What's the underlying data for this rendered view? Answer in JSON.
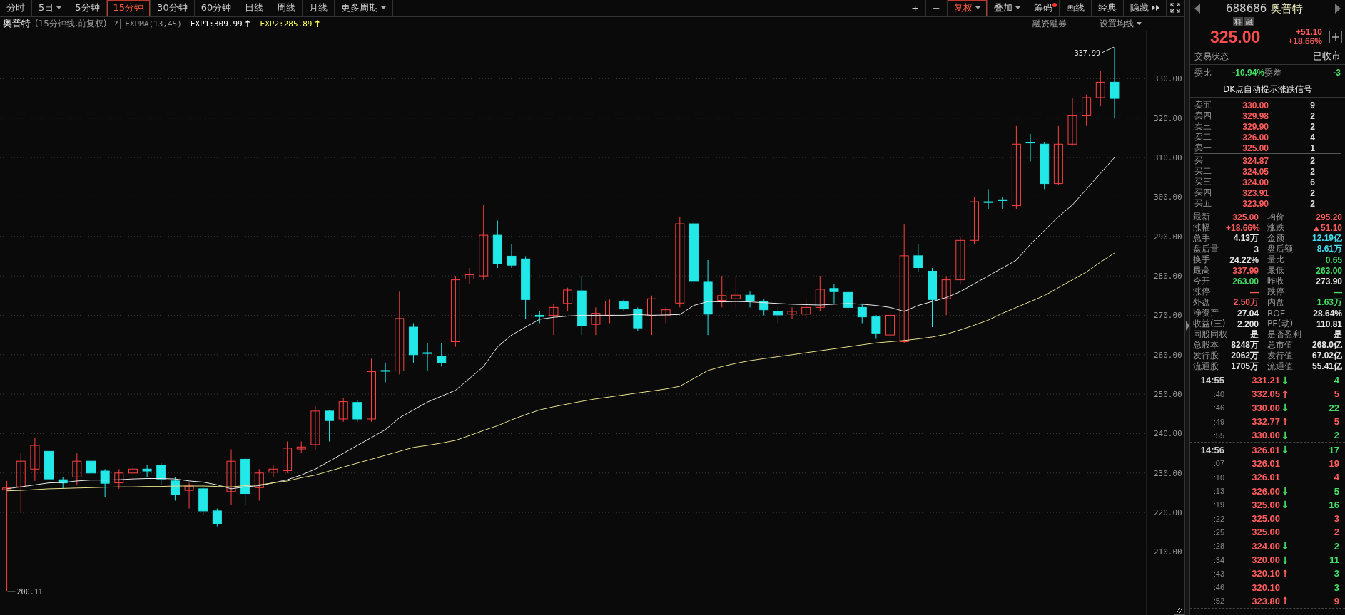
{
  "periods": [
    {
      "label": "分时",
      "selected": false,
      "dropdown": false
    },
    {
      "label": "5日",
      "selected": false,
      "dropdown": true
    },
    {
      "label": "5分钟",
      "selected": false,
      "dropdown": false
    },
    {
      "label": "15分钟",
      "selected": true,
      "dropdown": false
    },
    {
      "label": "30分钟",
      "selected": false,
      "dropdown": false
    },
    {
      "label": "60分钟",
      "selected": false,
      "dropdown": false
    },
    {
      "label": "日线",
      "selected": false,
      "dropdown": false
    },
    {
      "label": "周线",
      "selected": false,
      "dropdown": false
    },
    {
      "label": "月线",
      "selected": false,
      "dropdown": false
    },
    {
      "label": "更多周期",
      "selected": false,
      "dropdown": true
    }
  ],
  "tools": [
    {
      "kind": "text",
      "label": "+",
      "selected": false,
      "dropdown": false,
      "dot": false
    },
    {
      "kind": "text",
      "label": "−",
      "selected": false,
      "dropdown": false,
      "dot": false
    },
    {
      "kind": "text",
      "label": "复权",
      "selected": true,
      "dropdown": true,
      "dot": false
    },
    {
      "kind": "text",
      "label": "叠加",
      "selected": false,
      "dropdown": true,
      "dot": false
    },
    {
      "kind": "text",
      "label": "筹码",
      "selected": false,
      "dropdown": false,
      "dot": true
    },
    {
      "kind": "text",
      "label": "画线",
      "selected": false,
      "dropdown": false,
      "dot": false
    },
    {
      "kind": "text",
      "label": "经典",
      "selected": false,
      "dropdown": false,
      "dot": false
    },
    {
      "kind": "hide",
      "label": "隐藏",
      "selected": false
    },
    {
      "kind": "fullscreen",
      "selected": false
    }
  ],
  "info": {
    "name": "奥普特",
    "description": "(15分钟线,前复权)",
    "help": "?",
    "indicator": "EXPMA(13,45)",
    "values": [
      {
        "text": "EXP1:309.99",
        "color": "#ffffff",
        "arrow": "↑"
      },
      {
        "text": "EXP2:285.89",
        "color": "#ffff55",
        "arrow": "↑"
      }
    ],
    "links": [
      {
        "label": "融资融券",
        "dropdown": false
      },
      {
        "label": "设置均线",
        "dropdown": true
      }
    ]
  },
  "chart": {
    "chart_data": {
      "type": "candlestick",
      "ylim": [
        194,
        342
      ],
      "grid": true,
      "yticks": [
        {
          "value": 210,
          "label": "210.00"
        },
        {
          "value": 220,
          "label": "220.00"
        },
        {
          "value": 230,
          "label": "230.00"
        },
        {
          "value": 240,
          "label": "240.00"
        },
        {
          "value": 250,
          "label": "250.00"
        },
        {
          "value": 260,
          "label": "260.00"
        },
        {
          "value": 270,
          "label": "270.00"
        },
        {
          "value": 280,
          "label": "280.00"
        },
        {
          "value": 290,
          "label": "290.00"
        },
        {
          "value": 300,
          "label": "300.00"
        },
        {
          "value": 310,
          "label": "310.00"
        },
        {
          "value": 320,
          "label": "320.00"
        },
        {
          "value": 330,
          "label": "330.00"
        }
      ],
      "ohlc": [
        [
          225.8,
          228,
          200,
          226.2
        ],
        [
          226.5,
          235,
          220,
          233
        ],
        [
          231,
          239,
          228,
          237
        ],
        [
          235.5,
          236,
          227,
          228.5
        ],
        [
          228.3,
          229,
          226,
          227.5
        ],
        [
          229,
          235,
          227,
          233
        ],
        [
          233,
          234,
          229,
          230
        ],
        [
          230.5,
          231,
          224,
          227.4
        ],
        [
          227.5,
          231,
          226,
          230
        ],
        [
          230,
          232,
          228,
          231
        ],
        [
          231,
          232,
          229,
          230.5
        ],
        [
          232,
          232.5,
          227,
          228.5
        ],
        [
          228,
          229,
          223,
          224.5
        ],
        [
          225.6,
          227.5,
          221,
          226.7
        ],
        [
          226,
          226.5,
          219.5,
          220.4
        ],
        [
          220.4,
          221,
          216.5,
          217.1
        ],
        [
          225.3,
          236,
          222,
          233
        ],
        [
          233.5,
          234,
          222,
          224.8
        ],
        [
          226.3,
          231,
          223,
          230
        ],
        [
          230.2,
          232,
          229,
          231
        ],
        [
          230.6,
          238,
          230,
          236.3
        ],
        [
          236.1,
          238,
          235,
          236.6
        ],
        [
          237.2,
          247,
          236,
          245.7
        ],
        [
          245.7,
          246,
          238,
          243.3
        ],
        [
          243.7,
          249,
          243,
          248.1
        ],
        [
          247.9,
          248.5,
          243,
          243.7
        ],
        [
          243.7,
          259,
          243,
          255.7
        ],
        [
          256,
          258,
          253,
          255.8
        ],
        [
          255.9,
          276,
          255,
          269.2
        ],
        [
          267,
          268,
          258,
          260
        ],
        [
          260.5,
          263,
          256,
          260.3
        ],
        [
          259.6,
          263,
          257,
          258
        ],
        [
          263.3,
          280,
          262,
          279
        ],
        [
          279.2,
          282,
          278,
          280.3
        ],
        [
          280,
          298,
          279,
          290.3
        ],
        [
          290.3,
          294,
          282,
          283
        ],
        [
          285,
          288,
          282,
          282.7
        ],
        [
          284.3,
          285,
          269,
          274
        ],
        [
          270,
          271,
          268,
          269.7
        ],
        [
          270,
          273,
          265,
          272
        ],
        [
          273,
          277,
          271,
          276.4
        ],
        [
          276.2,
          280,
          265,
          267.3
        ],
        [
          267.7,
          272,
          265,
          270.5
        ],
        [
          270,
          274,
          268,
          273.6
        ],
        [
          273.4,
          274,
          271,
          271.6
        ],
        [
          271.6,
          272,
          266,
          266.8
        ],
        [
          270,
          275,
          265,
          274.2
        ],
        [
          269.9,
          272,
          268,
          271.4
        ],
        [
          273.1,
          295,
          272,
          293.2
        ],
        [
          293.2,
          294,
          278,
          278.6
        ],
        [
          278.4,
          284,
          265,
          270.3
        ],
        [
          273.8,
          280,
          272,
          275
        ],
        [
          274.2,
          280,
          272,
          275.1
        ],
        [
          275.1,
          276,
          272,
          273.6
        ],
        [
          273.6,
          274,
          270,
          271.4
        ],
        [
          271,
          272,
          268,
          270.1
        ],
        [
          270.3,
          272,
          269,
          271
        ],
        [
          270.3,
          274,
          269,
          272
        ],
        [
          272,
          280,
          271,
          276.6
        ],
        [
          276.8,
          278,
          273,
          276
        ],
        [
          275.8,
          276,
          271,
          272
        ],
        [
          272,
          273,
          268,
          269.6
        ],
        [
          269.6,
          270,
          264,
          265.5
        ],
        [
          265,
          272,
          263,
          270
        ],
        [
          263.3,
          293,
          263,
          285.1
        ],
        [
          285.1,
          288,
          281,
          282.1
        ],
        [
          281.2,
          282,
          267,
          274
        ],
        [
          274.2,
          280,
          270,
          279
        ],
        [
          279,
          290,
          278,
          289
        ],
        [
          289,
          300,
          288,
          298.8
        ],
        [
          298.8,
          302,
          297,
          298.6
        ],
        [
          299.3,
          300,
          297,
          299.1
        ],
        [
          297.8,
          318,
          297,
          313.4
        ],
        [
          313.9,
          316,
          309,
          313.7
        ],
        [
          313.4,
          314,
          302,
          303.4
        ],
        [
          303.4,
          318,
          303,
          313.4
        ],
        [
          313.4,
          325,
          313,
          320.6
        ],
        [
          320.6,
          326,
          318,
          325.2
        ],
        [
          325.2,
          332,
          323,
          329.1
        ],
        [
          329.1,
          338,
          320,
          325
        ]
      ],
      "series": [
        {
          "type": "line",
          "color": "#e8e8e8",
          "values": [
            226,
            226.5,
            227,
            227.5,
            227.6,
            228,
            228.2,
            228.2,
            228.3,
            228.5,
            228.6,
            228.6,
            228.5,
            228,
            227.7,
            227,
            226,
            226.5,
            226.8,
            227.5,
            228.3,
            229.5,
            231,
            233,
            235,
            237,
            239,
            241,
            244,
            246,
            248,
            249.5,
            251,
            254,
            257,
            262,
            265,
            267,
            269,
            269.5,
            269.8,
            270,
            270,
            270,
            270,
            270.2,
            270,
            270.1,
            270.2,
            272.5,
            273.5,
            273.4,
            273.5,
            273.4,
            273.2,
            273,
            272.8,
            272.7,
            272.6,
            272.8,
            273,
            272.8,
            272.5,
            272,
            271,
            272.5,
            273.5,
            274.5,
            276,
            278,
            280,
            282,
            284,
            288,
            291.5,
            295,
            298,
            302,
            306,
            310
          ]
        },
        {
          "type": "line",
          "color": "#e6df8a",
          "values": [
            225.5,
            225.6,
            225.8,
            226,
            226.1,
            226.2,
            226.3,
            226.4,
            226.5,
            226.5,
            226.6,
            226.6,
            226.7,
            226.7,
            226.7,
            226.6,
            226.5,
            226.8,
            227,
            227.5,
            228,
            228.8,
            229.5,
            230.5,
            231.5,
            232.5,
            233.5,
            234.5,
            235.5,
            236.5,
            237,
            237.6,
            238.3,
            239.5,
            240.8,
            242,
            243.5,
            244.8,
            246,
            246.8,
            247.5,
            248.2,
            248.8,
            249.3,
            249.8,
            250.3,
            250.8,
            251.3,
            252,
            254,
            256,
            257,
            257.8,
            258.5,
            259,
            259.5,
            260,
            260.5,
            261,
            261.5,
            262,
            262.5,
            263,
            263.3,
            263.6,
            264,
            264.5,
            265.2,
            266.3,
            267.5,
            268.8,
            270.5,
            272,
            273.5,
            275,
            277,
            279,
            281,
            283.5,
            285.8
          ]
        }
      ],
      "annotations": [
        "337.99",
        "200.11"
      ]
    }
  },
  "quote": {
    "code": "688686",
    "name": "奥普特",
    "badges": [
      "料",
      "融"
    ],
    "price": "325.00",
    "change": "+51.10",
    "change_pct": "+18.66%"
  },
  "status": {
    "label": "交易状态",
    "value": "已收市"
  },
  "ratio": [
    {
      "label": "委比",
      "value": "-10.94%",
      "color": "#44dd66"
    },
    {
      "label": "委差",
      "value": "-3",
      "color": "#44dd66"
    }
  ],
  "signal_link": "DK点自动提示涨跌信号",
  "asks": [
    {
      "label": "卖五",
      "price": "330.00",
      "volume": "9"
    },
    {
      "label": "卖四",
      "price": "329.98",
      "volume": "2"
    },
    {
      "label": "卖三",
      "price": "329.90",
      "volume": "2"
    },
    {
      "label": "卖二",
      "price": "326.00",
      "volume": "4"
    },
    {
      "label": "卖一",
      "price": "325.00",
      "volume": "1"
    }
  ],
  "bids": [
    {
      "label": "买一",
      "price": "324.87",
      "volume": "2"
    },
    {
      "label": "买二",
      "price": "324.05",
      "volume": "2"
    },
    {
      "label": "买三",
      "price": "324.00",
      "volume": "6"
    },
    {
      "label": "买四",
      "price": "323.91",
      "volume": "2"
    },
    {
      "label": "买五",
      "price": "323.90",
      "volume": "2"
    }
  ],
  "stats": [
    {
      "label": "最新",
      "value": "325.00",
      "color": "#ff5c5c"
    },
    {
      "label": "均价",
      "value": "295.20",
      "color": "#ff5c5c"
    },
    {
      "label": "涨幅",
      "value": "+18.66%",
      "color": "#ff5c5c"
    },
    {
      "label": "涨跌",
      "value": "▲51.10",
      "color": "#ff5c5c"
    },
    {
      "label": "总手",
      "value": "4.13万",
      "color": "#e8e8e8"
    },
    {
      "label": "金额",
      "value": "12.19亿",
      "color": "#44ddee"
    },
    {
      "label": "盘后量",
      "value": "3",
      "color": "#e8e8e8"
    },
    {
      "label": "盘后额",
      "value": "8.61万",
      "color": "#44ddee"
    },
    {
      "label": "换手",
      "value": "24.22%",
      "color": "#e8e8e8"
    },
    {
      "label": "量比",
      "value": "0.65",
      "color": "#44dd66"
    },
    {
      "label": "最高",
      "value": "337.99",
      "color": "#ff5c5c"
    },
    {
      "label": "最低",
      "value": "263.00",
      "color": "#44dd66"
    },
    {
      "label": "今开",
      "value": "263.00",
      "color": "#44dd66"
    },
    {
      "label": "昨收",
      "value": "273.90",
      "color": "#e8e8e8"
    },
    {
      "label": "涨停",
      "value": "—",
      "color": "#ff5c5c"
    },
    {
      "label": "跌停",
      "value": "—",
      "color": "#44dd66"
    },
    {
      "label": "外盘",
      "value": "2.50万",
      "color": "#ff5c5c"
    },
    {
      "label": "内盘",
      "value": "1.63万",
      "color": "#44dd66"
    },
    {
      "label": "净资产",
      "value": "27.04",
      "color": "#e8e8e8"
    },
    {
      "label": "ROE",
      "value": "28.64%",
      "color": "#e8e8e8"
    },
    {
      "label": "收益(三)",
      "value": "2.200",
      "color": "#e8e8e8"
    },
    {
      "label": "PE(动)",
      "value": "110.81",
      "color": "#e8e8e8"
    },
    {
      "label": "同股同权",
      "value": "是",
      "color": "#e8e8e8"
    },
    {
      "label": "是否盈利",
      "value": "是",
      "color": "#e8e8e8"
    },
    {
      "label": "总股本",
      "value": "8248万",
      "color": "#e8e8e8"
    },
    {
      "label": "总市值",
      "value": "268.0亿",
      "color": "#e8e8e8"
    },
    {
      "label": "发行股",
      "value": "2062万",
      "color": "#e8e8e8"
    },
    {
      "label": "发行值",
      "value": "67.02亿",
      "color": "#e8e8e8"
    },
    {
      "label": "流通股",
      "value": "1705万",
      "color": "#e8e8e8"
    },
    {
      "label": "流通值",
      "value": "55.41亿",
      "color": "#e8e8e8"
    }
  ],
  "trade_groups": [
    {
      "trades": [
        {
          "time": "14:55",
          "price": "331.21",
          "arrow": "↓",
          "rising": false,
          "volume": "4",
          "color": "#44dd66"
        },
        {
          "time": ":40",
          "price": "332.05",
          "arrow": "↑",
          "rising": true,
          "volume": "5",
          "color": "#ff5c5c"
        },
        {
          "time": ":46",
          "price": "330.00",
          "arrow": "↓",
          "rising": false,
          "volume": "22",
          "color": "#44dd66"
        },
        {
          "time": ":49",
          "price": "332.77",
          "arrow": "↑",
          "rising": true,
          "volume": "5",
          "color": "#ff5c5c"
        },
        {
          "time": ":55",
          "price": "330.00",
          "arrow": "↓",
          "rising": false,
          "volume": "2",
          "color": "#44dd66"
        }
      ]
    },
    {
      "trades": [
        {
          "time": "14:56",
          "price": "326.01",
          "arrow": "↓",
          "rising": false,
          "volume": "17",
          "color": "#44dd66"
        },
        {
          "time": ":07",
          "price": "326.01",
          "volume": "19",
          "color": "#ff5c5c"
        },
        {
          "time": ":10",
          "price": "326.01",
          "volume": "4",
          "color": "#ff5c5c"
        },
        {
          "time": ":13",
          "price": "326.00",
          "arrow": "↓",
          "rising": false,
          "volume": "5",
          "color": "#44dd66"
        },
        {
          "time": ":19",
          "price": "325.00",
          "arrow": "↓",
          "rising": false,
          "volume": "16",
          "color": "#44dd66"
        },
        {
          "time": ":22",
          "price": "325.00",
          "volume": "3",
          "color": "#ff5c5c"
        },
        {
          "time": ":25",
          "price": "325.00",
          "volume": "2",
          "color": "#ff5c5c"
        },
        {
          "time": ":28",
          "price": "324.00",
          "arrow": "↓",
          "rising": false,
          "volume": "2",
          "color": "#44dd66"
        },
        {
          "time": ":34",
          "price": "320.00",
          "arrow": "↓",
          "rising": false,
          "volume": "11",
          "color": "#44dd66"
        },
        {
          "time": ":43",
          "price": "320.10",
          "arrow": "↑",
          "rising": true,
          "volume": "3",
          "color": "#44dd66"
        },
        {
          "time": ":46",
          "price": "320.10",
          "volume": "3",
          "color": "#44dd66"
        },
        {
          "time": ":52",
          "price": "323.80",
          "arrow": "↑",
          "rising": true,
          "volume": "9",
          "color": "#ff5c5c"
        }
      ]
    }
  ]
}
